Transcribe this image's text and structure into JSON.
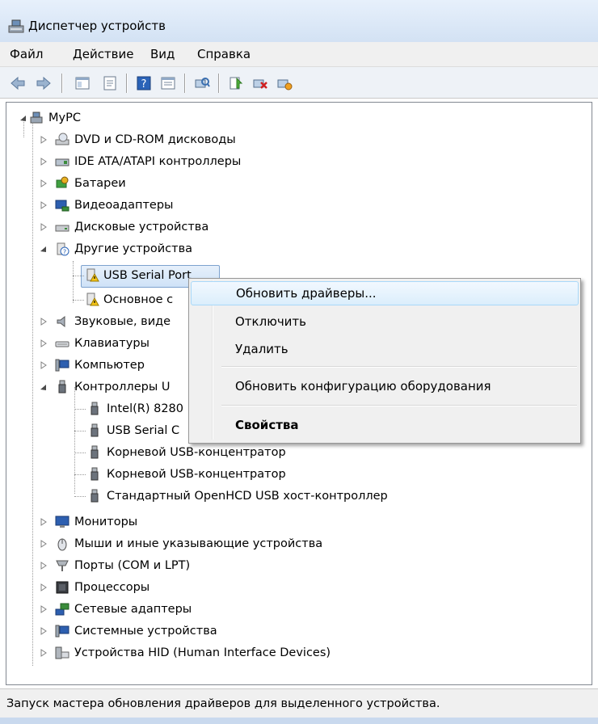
{
  "window": {
    "title": "Диспетчер устройств"
  },
  "menu": [
    "Файл",
    "Действие",
    "Вид",
    "Справка"
  ],
  "toolbar": {
    "icons": [
      "back-icon",
      "forward-icon",
      "show-hide-tree-icon",
      "properties-icon",
      "help-icon",
      "view-icon",
      "scan-hardware-icon",
      "update-driver-icon",
      "uninstall-icon",
      "disable-icon"
    ]
  },
  "tree": {
    "root": "MyPC",
    "items": [
      "DVD и CD-ROM дисководы",
      "IDE ATA/ATAPI контроллеры",
      "Батареи",
      "Видеоадаптеры",
      "Дисковые устройства",
      "Другие устройства",
      "USB Serial Port",
      "Основное с",
      "Звуковые, виде",
      "Клавиатуры",
      "Компьютер",
      "Контроллеры U",
      "Intel(R) 8280",
      "USB Serial C",
      "Корневой USB-концентратор",
      "Корневой USB-концентратор",
      "Стандартный OpenHCD USB хост-контроллер",
      "Мониторы",
      "Мыши и иные указывающие устройства",
      "Порты (COM и LPT)",
      "Процессоры",
      "Сетевые адаптеры",
      "Системные устройства",
      "Устройства HID (Human Interface Devices)"
    ]
  },
  "context_menu": {
    "update_drivers": "Обновить драйверы...",
    "disable": "Отключить",
    "delete": "Удалить",
    "scan": "Обновить конфигурацию оборудования",
    "properties": "Свойства"
  },
  "status": {
    "text": "Запуск мастера обновления драйверов для выделенного устройства."
  }
}
